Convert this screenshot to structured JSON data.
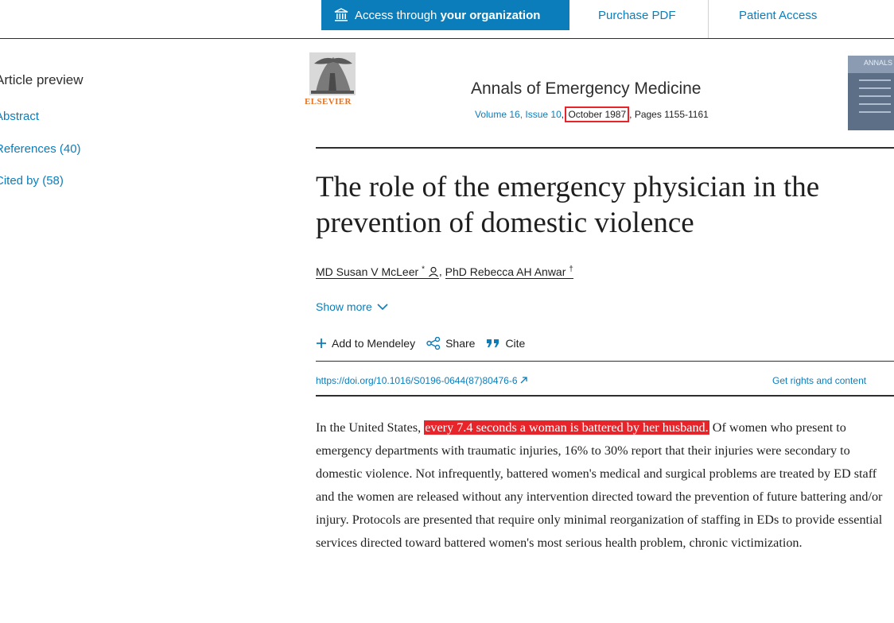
{
  "topbar": {
    "access_prefix": "Access through ",
    "access_bold": "your organization",
    "purchase_pdf": "Purchase PDF",
    "patient_access": "Patient Access",
    "access_color": "#0c7dbb"
  },
  "sidebar": {
    "title": "Article preview",
    "items": [
      {
        "label": "Abstract"
      },
      {
        "label": "References (40)"
      },
      {
        "label": "Cited by (58)"
      }
    ]
  },
  "journal": {
    "publisher": "ELSEVIER",
    "name": "Annals of Emergency Medicine",
    "volume_issue": "Volume 16, Issue 10",
    "date": "October 1987",
    "pages": ", Pages 1155-1161",
    "cover_label": "ANNALS"
  },
  "article": {
    "title": "The role of the emergency physician in the prevention of domestic violence",
    "authors": [
      {
        "name": "MD Susan V McLeer",
        "mark": "*"
      },
      {
        "name": "PhD Rebecca AH Anwar",
        "mark": "†"
      }
    ],
    "author_separator": ",",
    "show_more": "Show more",
    "actions": {
      "mendeley": "Add to Mendeley",
      "share": "Share",
      "cite": "Cite"
    },
    "doi": "https://doi.org/10.1016/S0196-0644(87)80476-6",
    "rights": "Get rights and content"
  },
  "abstract": {
    "before": "In the United States, ",
    "highlight": "every 7.4 seconds a woman is battered by her husband.",
    "after": " Of women who present to emergency departments with traumatic injuries, 16% to 30% report that their injuries were secondary to domestic violence. Not infrequently, battered women's medical and surgical problems are treated by ED staff and the women are released without any intervention directed toward the prevention of future battering and/or injury. Protocols are presented that require only minimal reorganization of staffing in EDs to provide essential services directed toward battered women's most serious health problem, chronic victimization.",
    "highlight_color": "#e8242b"
  }
}
